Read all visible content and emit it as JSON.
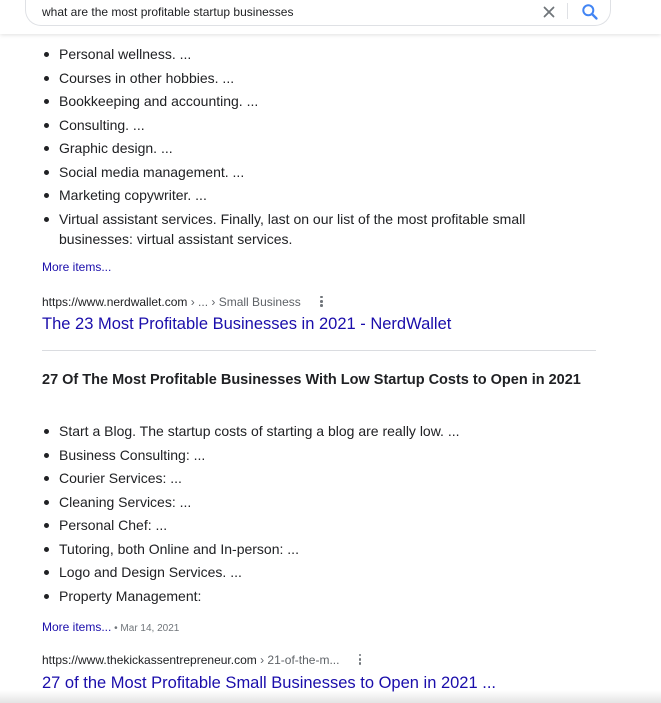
{
  "search": {
    "query": "what are the most profitable startup businesses"
  },
  "icons": {
    "clear": "close-icon",
    "search": "search-icon",
    "more": "more-vert-icon"
  },
  "colors": {
    "link": "#1a0dab",
    "search_icon": "#4285f4",
    "text": "#202124",
    "muted": "#5f6368"
  },
  "result1": {
    "bullets": [
      "Personal wellness. ...",
      "Courses in other hobbies. ...",
      "Bookkeeping and accounting. ...",
      "Consulting. ...",
      "Graphic design. ...",
      "Social media management. ...",
      "Marketing copywriter. ...",
      "Virtual assistant services. Finally, last on our list of the most profitable small businesses: virtual assistant services."
    ],
    "more_items": "More items...",
    "url": "https://www.nerdwallet.com",
    "breadcrumb": " › ... › Small Business",
    "title": "The 23 Most Profitable Businesses in 2021 - NerdWallet"
  },
  "result2": {
    "heading": "27 Of The Most Profitable Businesses With Low Startup Costs to Open in 2021",
    "bullets": [
      "Start a Blog. The startup costs of starting a blog are really low. ...",
      "Business Consulting: ...",
      "Courier Services: ...",
      "Cleaning Services: ...",
      "Personal Chef: ...",
      "Tutoring, both Online and In-person: ...",
      "Logo and Design Services. ...",
      "Property Management:"
    ],
    "more_items": "More items...",
    "date_separator": " • ",
    "date": "Mar 14, 2021",
    "url": "https://www.thekickassentrepreneur.com",
    "breadcrumb": " › 21-of-the-m...",
    "title": "27 of the Most Profitable Small Businesses to Open in 2021 ..."
  }
}
